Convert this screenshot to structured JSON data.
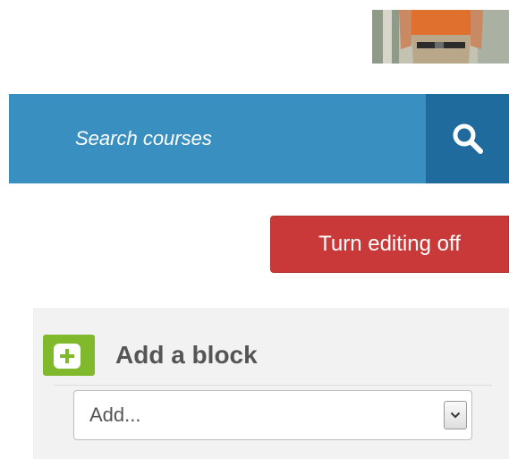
{
  "user": {
    "avatar": "user-avatar-photo"
  },
  "search": {
    "placeholder": "Search courses",
    "value": "",
    "button_icon": "search-icon"
  },
  "editing": {
    "toggle_label": "Turn editing off",
    "color": "#c9393a"
  },
  "add_block": {
    "title": "Add a block",
    "icon": "plus-icon",
    "select_value": "Add...",
    "select_arrow_icon": "chevron-down-icon"
  },
  "colors": {
    "search_bar": "#3a8fc1",
    "search_button": "#1f6b9d",
    "block_icon": "#80b92c",
    "panel_background": "#f2f2f2"
  }
}
